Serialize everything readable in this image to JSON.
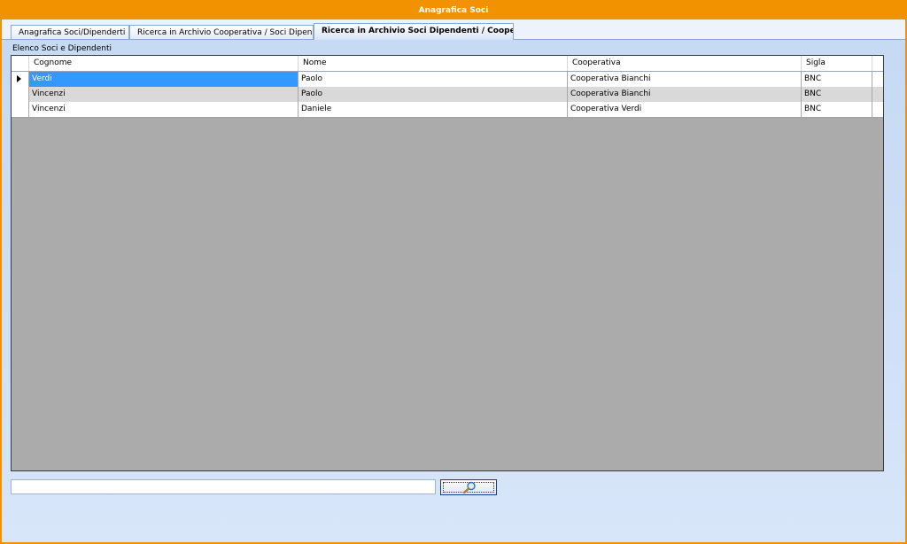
{
  "window": {
    "title": "Anagrafica Soci"
  },
  "tabs": [
    {
      "label": "Anagrafica Soci/Dipenderti"
    },
    {
      "label": "Ricerca in Archivio  Cooperativa / Soci Dipendenti"
    },
    {
      "label": "Ricerca in Archivio Soci Dipendenti / Cooperativa"
    }
  ],
  "active_tab": 2,
  "main": {
    "caption": "Elenco Soci e Dipendenti",
    "columns": [
      "Cognome",
      "Nome",
      "Cooperativa",
      "Sigla"
    ],
    "rows": [
      {
        "cognome": "Verdi",
        "nome": "Paolo",
        "cooperativa": "Cooperativa Bianchi",
        "sigla": "BNC"
      },
      {
        "cognome": "Vincenzi",
        "nome": "Paolo",
        "cooperativa": "Cooperativa Bianchi",
        "sigla": "BNC"
      },
      {
        "cognome": "Vincenzi",
        "nome": "Daniele",
        "cooperativa": "Cooperativa Verdi",
        "sigla": "BNC"
      }
    ],
    "selected_row": 0
  },
  "search": {
    "value": "",
    "placeholder": "",
    "button_icon": "search-icon"
  },
  "colors": {
    "title_bar": "#f29200",
    "selection": "#3399ff"
  }
}
